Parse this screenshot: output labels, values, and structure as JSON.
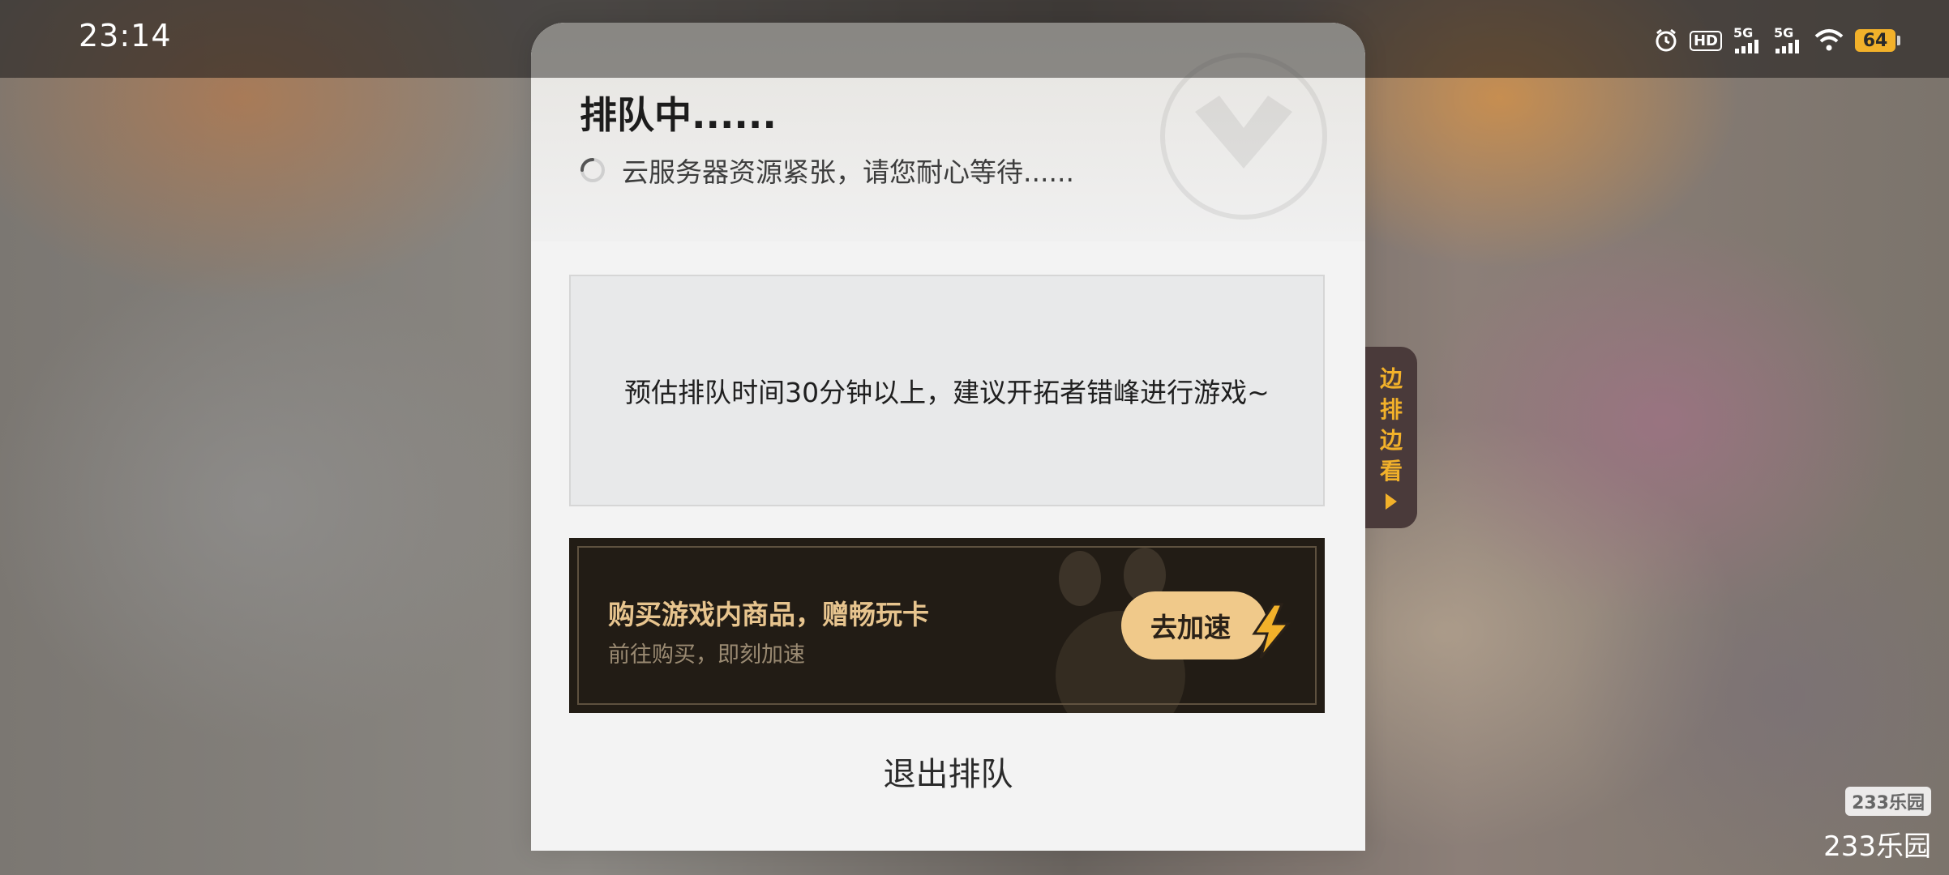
{
  "status_bar": {
    "time": "23:14",
    "hd_label": "HD",
    "sim1_label": "5G",
    "sim2_label": "5G",
    "battery": "64"
  },
  "dialog": {
    "title": "排队中......",
    "subtitle": "云服务器资源紧张，请您耐心等待......",
    "notice": "预估排队时间30分钟以上，建议开拓者错峰进行游戏~",
    "promo": {
      "title": "购买游戏内商品，赠畅玩卡",
      "subtitle": "前往购买，即刻加速",
      "button_label": "去加速"
    },
    "exit_label": "退出排队"
  },
  "side_tab": {
    "chars": [
      "边",
      "排",
      "边",
      "看"
    ]
  },
  "watermark": {
    "logo": "233乐园",
    "text": "233乐园"
  },
  "colors": {
    "accent": "#f2b12a",
    "promo_bg": "#221c15",
    "promo_title": "#e7c48e",
    "promo_button": "#f0c98a"
  }
}
